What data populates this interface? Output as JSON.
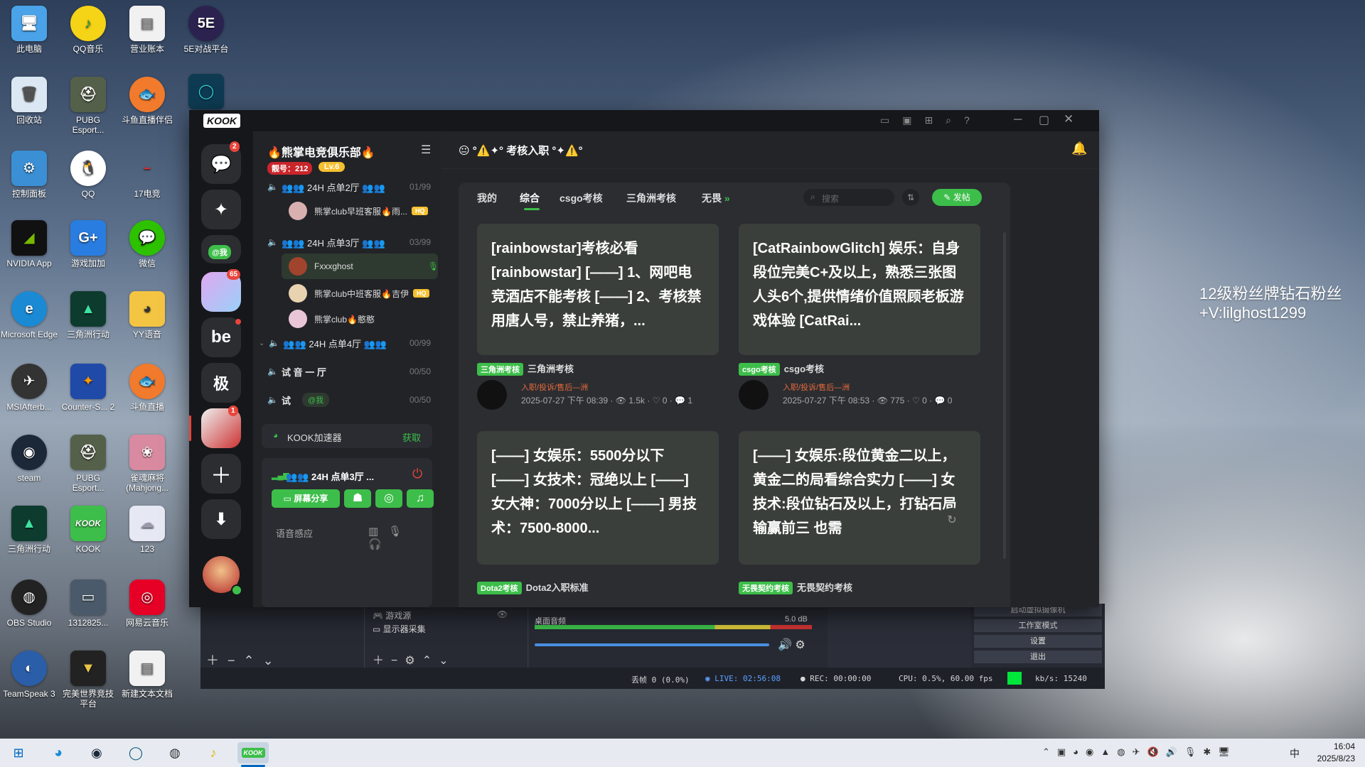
{
  "desktop": {
    "col1": [
      "此电脑",
      "回收站",
      "控制面板",
      "NVIDIA App",
      "Microsoft Edge",
      "MSIAfterb...",
      "steam",
      "三角洲行动",
      "OBS Studio",
      "TeamSpeak 3"
    ],
    "col2": [
      "QQ音乐",
      "PUBG Esport...",
      "QQ",
      "游戏加加",
      "三角洲行动",
      "Counter-S... 2",
      "PUBG Esport...",
      "KOOK",
      "1312825...",
      "完美世界竞技平台"
    ],
    "col3": [
      "营业账本",
      "斗鱼直播伴侣",
      "17电竞",
      "微信",
      "YY语音",
      "斗鱼直播",
      "雀魂麻将(Mahjong...",
      "123",
      "网易云音乐",
      "新建文本文档"
    ],
    "col4": [
      "5E对战平台"
    ]
  },
  "watermark": {
    "line1": "12级粉丝牌钻石粉丝",
    "line2": "+V:lilghost1299"
  },
  "kook": {
    "logo": "KOOK",
    "guild_badges": [
      "2",
      "65",
      "1"
    ],
    "mention": "@我",
    "guild_labels": [
      "be",
      "极"
    ],
    "server": {
      "name": "🔥熊掌电竞俱乐部🔥",
      "id_label": "靓号：212",
      "level": "Lv.6"
    },
    "channels": [
      {
        "name": "👥👥 24H 点单2厅 👥👥",
        "count": "01/99"
      },
      {
        "name": "👥👥 24H 点单3厅 👥👥",
        "count": "03/99"
      },
      {
        "name": "👥👥 24H 点单4厅 👥👥",
        "count": "00/99"
      },
      {
        "name": "试 音 一 厅",
        "count": "00/50"
      },
      {
        "name": "试",
        "count": "00/50"
      }
    ],
    "users": [
      "熊掌club早班客服🔥雨...",
      "Fxxxghost",
      "熊掌club中班客服🔥吉伊",
      "熊掌club🔥憨憨"
    ],
    "user_badge": "HQ",
    "accelerator": {
      "label": "KOOK加速器",
      "action": "获取"
    },
    "voice": {
      "channel": "👥👥 24H 点单3厅 ...",
      "share": "屏幕分享",
      "sensing": "语音感应"
    },
    "header": {
      "title": "😐 °⚠️✦° 考核入职 °✦⚠️°"
    },
    "tabs": [
      "我的",
      "综合",
      "csgo考核",
      "三角洲考核",
      "无畏"
    ],
    "search_placeholder": "搜索",
    "post_button": "发帖",
    "cards": [
      {
        "text": "[rainbowstar]考核必看[rainbowstar] [——] 1、网吧电竞酒店不能考核 [——] 2、考核禁用唐人号，禁止养猪，...",
        "tag": "三角洲考核",
        "category": "三角洲考核",
        "author": "入职/投诉/售后—洲",
        "time": "2025-07-27 下午 08:39",
        "views": "1.5k",
        "likes": "0",
        "comments": "1"
      },
      {
        "text": "[CatRainbowGlitch] 娱乐：自身段位完美C+及以上，熟悉三张图 人头6个,提供情绪价值照顾老板游戏体验 [CatRai...",
        "tag": "csgo考核",
        "category": "csgo考核",
        "author": "入职/投诉/售后—洲",
        "time": "2025-07-27 下午 08:53",
        "views": "775",
        "likes": "0",
        "comments": "0"
      },
      {
        "text": "[——] 女娱乐：5500分以下 [——] 女技术：冠绝以上 [——] 女大神：7000分以上 [——] 男技术：7500-8000...",
        "tag": "Dota2考核",
        "category": "Dota2入职标准"
      },
      {
        "text": "[——] 女娱乐:段位黄金二以上，黄金二的局看综合实力 [——] 女技术:段位钻石及以上，打钻石局输赢前三 也需",
        "tag": "无畏契约考核",
        "category": "无畏契约考核"
      }
    ]
  },
  "obs": {
    "sources": [
      "游戏源",
      "显示器采集"
    ],
    "mixer_label": "桌面音频",
    "db": "5.0 dB",
    "controls": [
      "启动虚拟摄像机",
      "工作室模式",
      "设置",
      "退出"
    ],
    "status": {
      "dropped": "丢帧 0 (0.0%)",
      "live": "LIVE: 02:56:08",
      "rec": "REC: 00:00:00",
      "cpu": "CPU: 0.5%, 60.00 fps",
      "kbps": "kb/s: 15240"
    }
  },
  "taskbar": {
    "time": "16:04",
    "date": "2025/8/23",
    "ime": "中"
  },
  "colors": {
    "accent": "#3dbe4a",
    "badge": "#e8453c",
    "card": "#3a3f3b"
  }
}
